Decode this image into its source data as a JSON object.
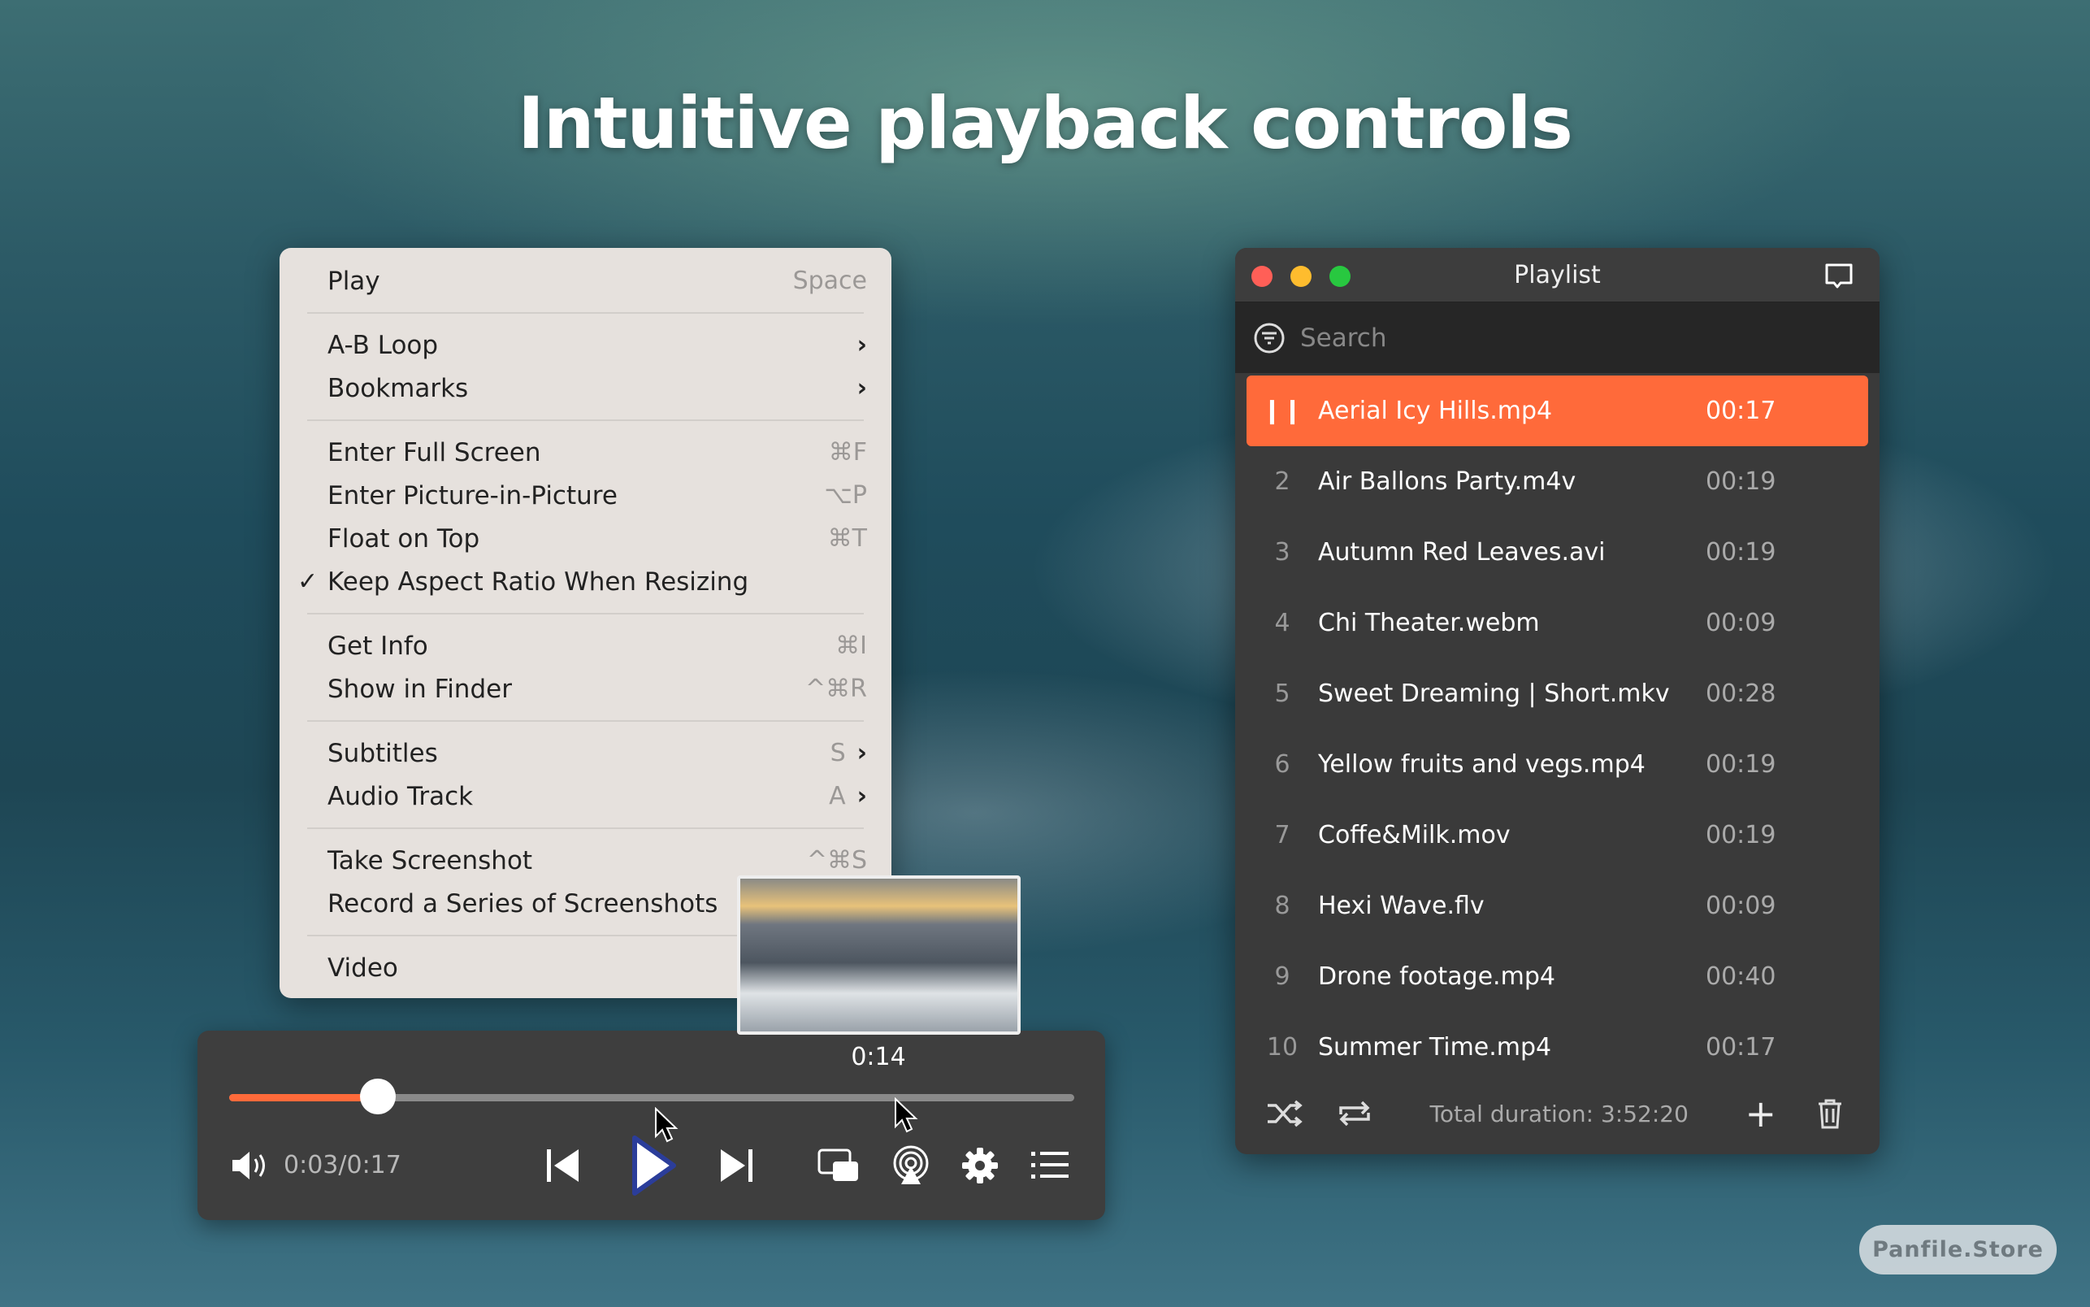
{
  "headline": "Intuitive playback controls",
  "context_menu": {
    "items": [
      {
        "label": "Play",
        "shortcut": "Space"
      },
      {
        "label": "A-B Loop",
        "submenu": true
      },
      {
        "label": "Bookmarks",
        "submenu": true
      },
      {
        "label": "Enter Full Screen",
        "shortcut": "⌘F"
      },
      {
        "label": "Enter Picture-in-Picture",
        "shortcut": "⌥P"
      },
      {
        "label": "Float on Top",
        "shortcut": "⌘T"
      },
      {
        "label": "Keep Aspect Ratio When Resizing",
        "checked": true,
        "check": "✓"
      },
      {
        "label": "Get Info",
        "shortcut": "⌘I"
      },
      {
        "label": "Show in Finder",
        "shortcut": "^⌘R"
      },
      {
        "label": "Subtitles",
        "shortcut": "S",
        "submenu": true
      },
      {
        "label": "Audio Track",
        "shortcut": "A",
        "submenu": true
      },
      {
        "label": "Take Screenshot",
        "shortcut": "^⌘S"
      },
      {
        "label": "Record a Series of Screenshots"
      },
      {
        "label": "Video"
      }
    ],
    "chevron": "›"
  },
  "player": {
    "hover_time": "0:14",
    "time": "0:03/0:17",
    "progress": 0.176,
    "accent": "#ff6a3a",
    "icons": [
      "volume-icon",
      "previous-icon",
      "play-icon",
      "next-icon",
      "pip-icon",
      "airplay-icon",
      "gear-icon",
      "list-icon"
    ]
  },
  "playlist": {
    "title": "Playlist",
    "search_placeholder": "Search",
    "playing_icon": "pause-icon",
    "items": [
      {
        "num": "",
        "name": "Aerial Icy Hills.mp4",
        "duration": "00:17",
        "active": true
      },
      {
        "num": "2",
        "name": "Air Ballons Party.m4v",
        "duration": "00:19"
      },
      {
        "num": "3",
        "name": "Autumn Red Leaves.avi",
        "duration": "00:19"
      },
      {
        "num": "4",
        "name": "Chi Theater.webm",
        "duration": "00:09"
      },
      {
        "num": "5",
        "name": "Sweet Dreaming | Short.mkv",
        "duration": "00:28"
      },
      {
        "num": "6",
        "name": "Yellow fruits and vegs.mp4",
        "duration": "00:19"
      },
      {
        "num": "7",
        "name": "Coffe&Milk.mov",
        "duration": "00:19"
      },
      {
        "num": "8",
        "name": "Hexi Wave.flv",
        "duration": "00:09"
      },
      {
        "num": "9",
        "name": "Drone footage.mp4",
        "duration": "00:40"
      },
      {
        "num": "10",
        "name": "Summer Time.mp4",
        "duration": "00:17"
      }
    ],
    "total_duration": "Total duration: 3:52:20"
  },
  "watermark": "Panfile.Store"
}
